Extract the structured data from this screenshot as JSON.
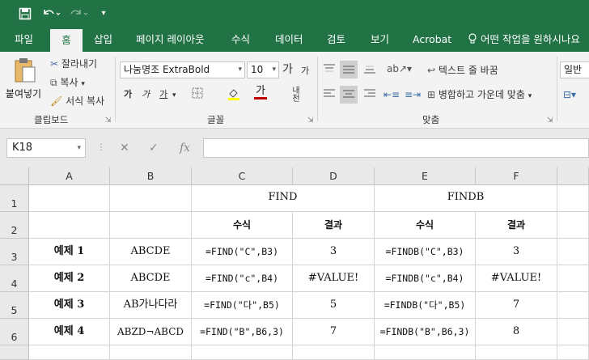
{
  "quick_access": {
    "save_icon": "save-icon",
    "undo_icon": "undo-icon",
    "redo_icon": "redo-icon",
    "customize_icon": "customize-icon"
  },
  "tabs": [
    "파일",
    "홈",
    "삽입",
    "페이지 레이아웃",
    "수식",
    "데이터",
    "검토",
    "보기",
    "Acrobat"
  ],
  "active_tab": "홈",
  "tell_me": "어떤 작업을 원하시나요",
  "clipboard": {
    "paste": "붙여넣기",
    "cut": "잘라내기",
    "copy": "복사",
    "format_painter": "서식 복사",
    "group": "클립보드"
  },
  "font": {
    "name": "나눔명조 ExtraBold",
    "size": "10",
    "group": "글꼴",
    "bold": "가",
    "italic": "가",
    "underline": "가",
    "grow": "가",
    "shrink": "가",
    "phonetic": "내천"
  },
  "alignment": {
    "wrap": "텍스트 줄 바꿈",
    "merge": "병합하고 가운데 맞춤",
    "group": "맞춤"
  },
  "number": {
    "format": "일반"
  },
  "formula_bar": {
    "name_box": "K18",
    "fx": "fx",
    "value": ""
  },
  "columns": [
    "A",
    "B",
    "C",
    "D",
    "E",
    "F"
  ],
  "rows": [
    "1",
    "2",
    "3",
    "4",
    "5",
    "6"
  ],
  "cells": {
    "r1": {
      "find": "FIND",
      "findb": "FINDB"
    },
    "r2": {
      "c": "수식",
      "d": "결과",
      "e": "수식",
      "f": "결과"
    },
    "r3": {
      "a": "예제 1",
      "b": "ABCDE",
      "c": "=FIND(\"C\",B3)",
      "d": "3",
      "e": "=FINDB(\"C\",B3)",
      "f": "3"
    },
    "r4": {
      "a": "예제 2",
      "b": "ABCDE",
      "c": "=FIND(\"c\",B4)",
      "d": "#VALUE!",
      "e": "=FINDB(\"c\",B4)",
      "f": "#VALUE!"
    },
    "r5": {
      "a": "예제 3",
      "b": "AB가나다라",
      "c": "=FIND(\"다\",B5)",
      "d": "5",
      "e": "=FINDB(\"다\",B5)",
      "f": "7"
    },
    "r6": {
      "a": "예제 4",
      "b": "ABZD¬ABCD",
      "c": "=FIND(\"B\",B6,3)",
      "d": "7",
      "e": "=FINDB(\"B\",B6,3)",
      "f": "8"
    }
  },
  "colors": {
    "brand": "#217346",
    "ribbon": "#f3f3f3",
    "accent_red": "#c00000",
    "accent_yellow": "#ffff00"
  }
}
